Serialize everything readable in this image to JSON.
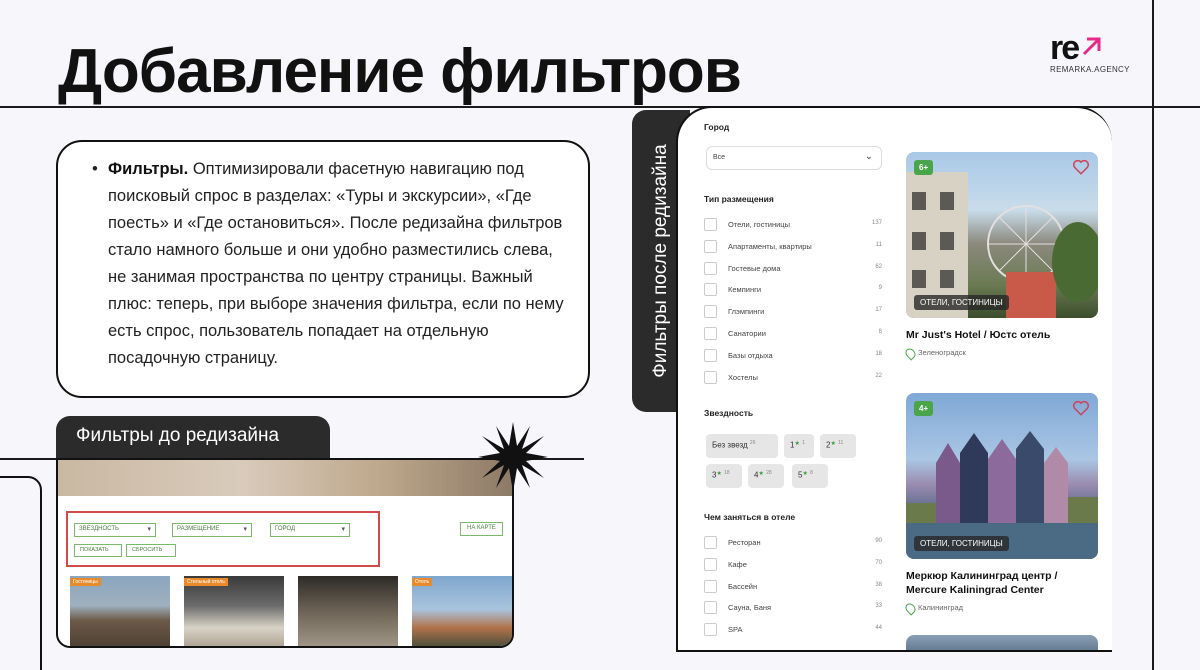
{
  "slide": {
    "title": "Добавление фильтров",
    "logo": {
      "mark": "re",
      "subtitle": "REMARKA.AGENCY"
    },
    "description": {
      "bold": "Фильтры.",
      "text": " Оптимизировали фасетную навигацию под поисковый спрос в разделах: «Туры и экскурсии», «Где поесть» и «Где остановиться». После редизайна фильтров стало намного больше и они удобно разместились слева, не занимая пространства по центру страницы. Важный плюс: теперь, при выборе значения фильтра, если по нему есть спрос, пользователь попадает на отдельную посадочную страницу."
    },
    "before_label": "Фильтры до редизайна",
    "after_label": "Фильтры после редизайна"
  },
  "old_ui": {
    "selects": [
      "ЗВЕЗДНОСТЬ",
      "РАЗМЕЩЕНИЕ",
      "ГОРОД"
    ],
    "buttons": [
      "ПОКАЗАТЬ",
      "СБРОСИТЬ"
    ],
    "map_button": "НА КАРТЕ",
    "thumb_tags": [
      "Гостиницы",
      "Стильный отель",
      "",
      "Отель"
    ]
  },
  "new_ui": {
    "city": {
      "title": "Город",
      "value": "Все"
    },
    "placement": {
      "title": "Тип размещения",
      "items": [
        {
          "label": "Отели, гостиницы",
          "count": "137"
        },
        {
          "label": "Апартаменты, квартиры",
          "count": "11"
        },
        {
          "label": "Гостевые дома",
          "count": "62"
        },
        {
          "label": "Кемпинги",
          "count": "9"
        },
        {
          "label": "Глэмпинги",
          "count": "17"
        },
        {
          "label": "Санатории",
          "count": "8"
        },
        {
          "label": "Базы отдыха",
          "count": "18"
        },
        {
          "label": "Хостелы",
          "count": "22"
        }
      ]
    },
    "stars": {
      "title": "Звездность",
      "chips": [
        {
          "label": "Без звезд",
          "count": "26"
        },
        {
          "label": "1",
          "count": "1"
        },
        {
          "label": "2",
          "count": "11"
        },
        {
          "label": "3",
          "count": "18"
        },
        {
          "label": "4",
          "count": "28"
        },
        {
          "label": "5",
          "count": "8"
        }
      ]
    },
    "activities": {
      "title": "Чем заняться в отеле",
      "items": [
        {
          "label": "Ресторан",
          "count": "90"
        },
        {
          "label": "Кафе",
          "count": "70"
        },
        {
          "label": "Бассейн",
          "count": "38"
        },
        {
          "label": "Сауна, Баня",
          "count": "33"
        },
        {
          "label": "SPA",
          "count": "44"
        }
      ]
    },
    "cards": [
      {
        "badge": "6+",
        "type": "ОТЕЛИ, ГОСТИНИЦЫ",
        "name": "Mr Just's Hotel / Юстс отель",
        "location": "Зеленоградск"
      },
      {
        "badge": "4+",
        "type": "ОТЕЛИ, ГОСТИНИЦЫ",
        "name": "Меркюр Калининград центр / Mercure Kaliningrad Center",
        "location": "Калининград"
      }
    ],
    "colors": {
      "accent": "#4aa54a",
      "heart": "#d0415a",
      "logo_arrow": "#e8298a"
    }
  }
}
